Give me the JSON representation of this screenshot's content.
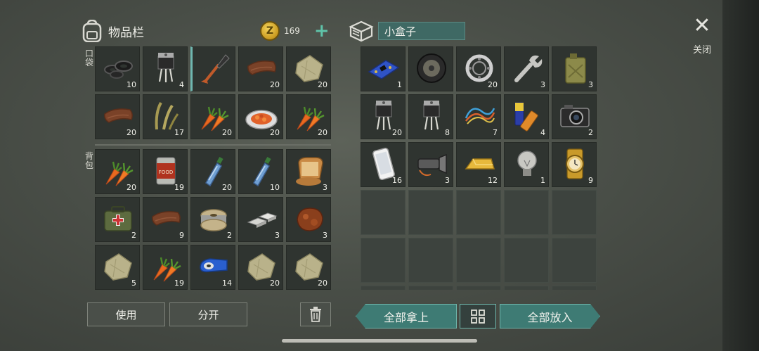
{
  "inventory": {
    "title": "物品栏",
    "icon": "backpack-icon"
  },
  "currency": {
    "value": "169",
    "icon": "coin-icon",
    "coin_letter": "Z",
    "plus": "+"
  },
  "container": {
    "name": "小盒子",
    "icon": "box-icon"
  },
  "labels": {
    "pocket": "口袋",
    "backpack": "背包"
  },
  "close": {
    "symbol": "✕",
    "label": "关闭"
  },
  "pocket_items": [
    {
      "icon": "washers-icon",
      "count": "10"
    },
    {
      "icon": "transistor-icon",
      "count": "4"
    },
    {
      "icon": "shovel-icon",
      "count": ""
    },
    {
      "icon": "leather-icon",
      "count": "20"
    },
    {
      "icon": "cloth-icon",
      "count": "20"
    },
    {
      "icon": "leather-icon",
      "count": "20"
    },
    {
      "icon": "plant-fiber-icon",
      "count": "17"
    },
    {
      "icon": "carrot-icon",
      "count": "20"
    },
    {
      "icon": "carrot-dish-icon",
      "count": "20"
    },
    {
      "icon": "carrot-icon",
      "count": "20"
    }
  ],
  "backpack_items": [
    {
      "icon": "carrot-icon",
      "count": "20"
    },
    {
      "icon": "canned-food-icon",
      "count": "19"
    },
    {
      "icon": "water-bottle-icon",
      "count": "20"
    },
    {
      "icon": "water-bottle-icon",
      "count": "10"
    },
    {
      "icon": "toast-icon",
      "count": "3"
    },
    {
      "icon": "first-aid-bag-icon",
      "count": "2"
    },
    {
      "icon": "leather-icon",
      "count": "9"
    },
    {
      "icon": "wire-spool-icon",
      "count": "2"
    },
    {
      "icon": "metal-bars-icon",
      "count": "3"
    },
    {
      "icon": "cooked-meat-icon",
      "count": "3"
    },
    {
      "icon": "cloth-icon",
      "count": "5"
    },
    {
      "icon": "carrot-icon",
      "count": "19"
    },
    {
      "icon": "tape-icon",
      "count": "14"
    },
    {
      "icon": "cloth-icon",
      "count": "20"
    },
    {
      "icon": "cloth-icon",
      "count": "20"
    }
  ],
  "box_items": [
    {
      "icon": "circuit-board-icon",
      "count": "1"
    },
    {
      "icon": "tire-icon",
      "count": ""
    },
    {
      "icon": "bearing-icon",
      "count": "20"
    },
    {
      "icon": "wrench-icon",
      "count": "3"
    },
    {
      "icon": "jerrycan-icon",
      "count": "3"
    },
    {
      "icon": "transistor-icon",
      "count": "20"
    },
    {
      "icon": "transistor-icon",
      "count": "8"
    },
    {
      "icon": "wires-icon",
      "count": "7"
    },
    {
      "icon": "batteries-icon",
      "count": "4"
    },
    {
      "icon": "camera-icon",
      "count": "2"
    },
    {
      "icon": "smartphone-icon",
      "count": "16"
    },
    {
      "icon": "flashlight-icon",
      "count": "3"
    },
    {
      "icon": "gold-bar-icon",
      "count": "12"
    },
    {
      "icon": "light-bulb-icon",
      "count": "1"
    },
    {
      "icon": "gold-watch-icon",
      "count": "9"
    },
    {
      "icon": "",
      "count": ""
    },
    {
      "icon": "",
      "count": ""
    },
    {
      "icon": "",
      "count": ""
    },
    {
      "icon": "",
      "count": ""
    },
    {
      "icon": "",
      "count": ""
    },
    {
      "icon": "",
      "count": ""
    },
    {
      "icon": "",
      "count": ""
    },
    {
      "icon": "",
      "count": ""
    },
    {
      "icon": "",
      "count": ""
    },
    {
      "icon": "",
      "count": ""
    },
    {
      "icon": "",
      "count": ""
    },
    {
      "icon": "",
      "count": ""
    },
    {
      "icon": "",
      "count": ""
    },
    {
      "icon": "",
      "count": ""
    },
    {
      "icon": "",
      "count": ""
    }
  ],
  "buttons": {
    "use": "使用",
    "split": "分开",
    "trash_icon": "trash-icon",
    "take_all": "全部拿上",
    "sort_icon": "grid-icon",
    "put_all": "全部放入"
  },
  "colors": {
    "accent": "#3e7b74",
    "coin": "#e2b53a",
    "plus": "#5fc3a9"
  }
}
